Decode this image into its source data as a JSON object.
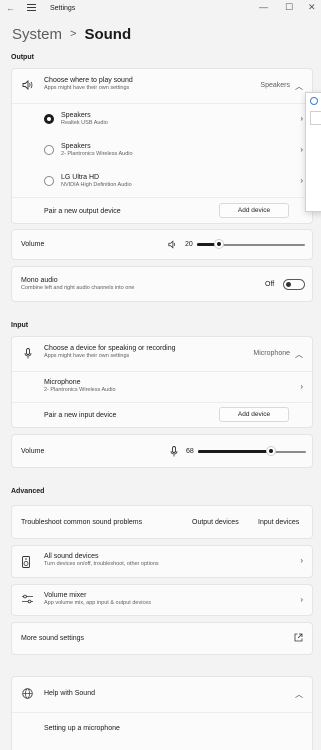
{
  "window": {
    "title": "Settings",
    "back": "←",
    "minimize": "—",
    "maximize": "☐",
    "close": "✕"
  },
  "breadcrumb": {
    "parent": "System",
    "separator": ">",
    "current": "Sound"
  },
  "output": {
    "label": "Output",
    "choose": {
      "title": "Choose where to play sound",
      "subtitle": "Apps might have their own settings",
      "value": "Speakers"
    },
    "devices": [
      {
        "name": "Speakers",
        "detail": "Realtek USB Audio",
        "selected": true
      },
      {
        "name": "Speakers",
        "detail": "2- Plantronics Wireless Audio",
        "selected": false
      },
      {
        "name": "LG Ultra HD",
        "detail": "NVIDIA High Definition Audio",
        "selected": false
      }
    ],
    "pair_label": "Pair a new output device",
    "add_button": "Add device",
    "volume_label": "Volume",
    "volume_value": "20",
    "volume_level": 20,
    "mono": {
      "title": "Mono audio",
      "subtitle": "Combine left and right audio channels into one",
      "state": "Off"
    }
  },
  "input": {
    "label": "Input",
    "choose": {
      "title": "Choose a device for speaking or recording",
      "subtitle": "Apps might have their own settings",
      "value": "Microphone"
    },
    "device": {
      "name": "Microphone",
      "detail": "2- Plantronics Wireless Audio"
    },
    "pair_label": "Pair a new input device",
    "add_button": "Add device",
    "volume_label": "Volume",
    "volume_value": "68",
    "volume_level": 68
  },
  "advanced": {
    "label": "Advanced",
    "troubleshoot": {
      "title": "Troubleshoot common sound problems",
      "output_link": "Output devices",
      "input_link": "Input devices"
    },
    "all_devices": {
      "title": "All sound devices",
      "subtitle": "Turn devices on/off, troubleshoot, other options"
    },
    "mixer": {
      "title": "Volume mixer",
      "subtitle": "App volume mix, app input & output devices"
    },
    "more": {
      "title": "More sound settings"
    }
  },
  "help": {
    "title": "Help with Sound",
    "link": "Setting up a microphone"
  },
  "icons": {
    "speaker": "speaker-icon",
    "microphone": "microphone-icon",
    "chevron": "chevron-right-icon",
    "external": "open-external-icon"
  }
}
